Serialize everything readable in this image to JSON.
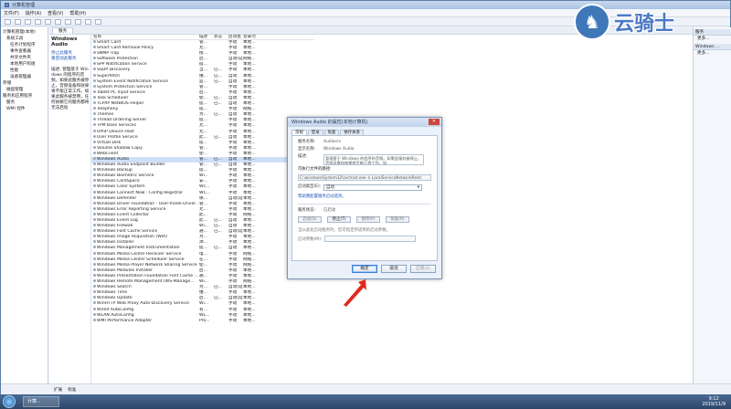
{
  "window": {
    "title": "计算机管理"
  },
  "menu": [
    "文件(F)",
    "操作(A)",
    "查看(V)",
    "帮助(H)"
  ],
  "tree": [
    "计算机管理(本地)",
    "系统工具",
    "任务计划程序",
    "事件查看器",
    "共享文件夹",
    "本地用户和组",
    "性能",
    "设备管理器",
    "存储",
    "磁盘管理",
    "服务和应用程序",
    "服务",
    "WMI 控件"
  ],
  "main_tab": "服务",
  "service_panel": {
    "title": "Windows Audio",
    "links": [
      "停止此服务",
      "重启动此服务"
    ],
    "description": "描述: 管理基于 Windows 的程序的音频。如果此服务被停止，音频设备和效果将不能正常工作。如果此服务被禁用，任何依赖它的服务都将无法启动"
  },
  "columns": [
    "名称",
    "描述",
    "状态",
    "启动类型",
    "登录为"
  ],
  "services": [
    [
      "Smart Card",
      "管...",
      "",
      "手动",
      "本地..."
    ],
    [
      "Smart Card Removal Policy",
      "允...",
      "",
      "手动",
      "本地..."
    ],
    [
      "SNMP Trap",
      "接...",
      "",
      "手动",
      "本地..."
    ],
    [
      "Software Protection",
      "启...",
      "",
      "自动(延迟...",
      "网络..."
    ],
    [
      "SPP Notification Service",
      "提...",
      "",
      "手动",
      "本地..."
    ],
    [
      "SSDP Discovery",
      "当...",
      "已...",
      "手动",
      "本地..."
    ],
    [
      "Superfetch",
      "维...",
      "已...",
      "自动",
      "本地..."
    ],
    [
      "System Event Notification Service",
      "监...",
      "已...",
      "自动",
      "本地..."
    ],
    [
      "System Protection Service",
      "管...",
      "",
      "手动",
      "本地..."
    ],
    [
      "Tablet PC Input Service",
      "启...",
      "",
      "手动",
      "本地..."
    ],
    [
      "Task Scheduler",
      "使...",
      "已...",
      "自动",
      "本地..."
    ],
    [
      "TCP/IP NetBIOS Helper",
      "提...",
      "已...",
      "自动",
      "本地..."
    ],
    [
      "Telephony",
      "提...",
      "",
      "手动",
      "网络..."
    ],
    [
      "Themes",
      "为...",
      "已...",
      "自动",
      "本地..."
    ],
    [
      "Thread Ordering Server",
      "提...",
      "",
      "手动",
      "本地..."
    ],
    [
      "TPM Base Services",
      "允...",
      "",
      "手动",
      "本地..."
    ],
    [
      "UPnP Device Host",
      "允...",
      "",
      "手动",
      "本地..."
    ],
    [
      "User Profile Service",
      "此...",
      "已...",
      "自动",
      "本地..."
    ],
    [
      "Virtual Disk",
      "提...",
      "",
      "手动",
      "本地..."
    ],
    [
      "Volume Shadow Copy",
      "管...",
      "",
      "手动",
      "本地..."
    ],
    [
      "WebClient",
      "使...",
      "",
      "手动",
      "本地..."
    ],
    [
      "Windows Audio",
      "管...",
      "已...",
      "自动",
      "本地..."
    ],
    [
      "Windows Audio Endpoint Builder",
      "管...",
      "已...",
      "自动",
      "本地..."
    ],
    [
      "Windows Backup",
      "提...",
      "",
      "手动",
      "本地..."
    ],
    [
      "Windows Biometric Service",
      "Wi...",
      "",
      "手动",
      "本地..."
    ],
    [
      "Windows CardSpace",
      "安...",
      "",
      "手动",
      "本地..."
    ],
    [
      "Windows Color System",
      "Wc...",
      "",
      "手动",
      "本地..."
    ],
    [
      "Windows Connect Now - Config Registrar",
      "WC...",
      "",
      "手动",
      "本地..."
    ],
    [
      "Windows Defender",
      "保...",
      "",
      "自动(延迟...",
      "本地..."
    ],
    [
      "Windows Driver Foundation - User-mode Driver ...",
      "管...",
      "",
      "手动",
      "本地..."
    ],
    [
      "Windows Error Reporting Service",
      "允...",
      "",
      "手动",
      "本地..."
    ],
    [
      "Windows Event Collector",
      "此...",
      "",
      "手动",
      "网络..."
    ],
    [
      "Windows Event Log",
      "此...",
      "已...",
      "自动",
      "本地..."
    ],
    [
      "Windows Firewall",
      "Wi...",
      "已...",
      "自动",
      "本地..."
    ],
    [
      "Windows Font Cache Service",
      "通...",
      "已...",
      "自动(延迟...",
      "本地..."
    ],
    [
      "Windows Image Acquisition (WIA)",
      "为...",
      "",
      "手动",
      "本地..."
    ],
    [
      "Windows Installer",
      "添...",
      "",
      "手动",
      "本地..."
    ],
    [
      "Windows Management Instrumentation",
      "提...",
      "已...",
      "自动",
      "本地..."
    ],
    [
      "Windows Media Center Receiver Service",
      "电...",
      "",
      "手动",
      "网络..."
    ],
    [
      "Windows Media Center Scheduler Service",
      "在...",
      "",
      "手动",
      "网络..."
    ],
    [
      "Windows Media Player Network Sharing Service",
      "使...",
      "",
      "手动",
      "网络..."
    ],
    [
      "Windows Modules Installer",
      "启...",
      "",
      "手动",
      "本地..."
    ],
    [
      "Windows Presentation Foundation Font Cache ...",
      "通...",
      "",
      "手动",
      "本地..."
    ],
    [
      "Windows Remote Management (WS-Manage...",
      "Wi...",
      "",
      "手动",
      "网络..."
    ],
    [
      "Windows Search",
      "为...",
      "已...",
      "自动(延迟...",
      "本地..."
    ],
    [
      "Windows Time",
      "维...",
      "",
      "手动",
      "本地..."
    ],
    [
      "Windows Update",
      "启...",
      "已...",
      "自动(延迟...",
      "本地..."
    ],
    [
      "WinHTTP Web Proxy Auto-Discovery Service",
      "Wi...",
      "",
      "手动",
      "本地..."
    ],
    [
      "Wired AutoConfig",
      "有...",
      "",
      "手动",
      "本地..."
    ],
    [
      "WLAN AutoConfig",
      "WL...",
      "",
      "手动",
      "本地..."
    ],
    [
      "WMI Performance Adapter",
      "Pro...",
      "",
      "手动",
      "本地..."
    ]
  ],
  "selected_service_index": 21,
  "actions": {
    "groups": [
      {
        "header": "服务",
        "items": [
          "更多..."
        ]
      },
      {
        "header": "Windows ...",
        "items": [
          "更多..."
        ]
      }
    ]
  },
  "status_tabs": [
    "扩展",
    "标准"
  ],
  "dialog": {
    "title": "Windows Audio 的属性(本地计算机)",
    "close": "✕",
    "tabs": [
      "常规",
      "登录",
      "恢复",
      "依存关系"
    ],
    "fields": {
      "service_name_label": "服务名称:",
      "service_name": "Audiosrv",
      "display_name_label": "显示名称:",
      "display_name": "Windows Audio",
      "description_label": "描述:",
      "description": "管理基于 Windows 的程序的音频。如果此服务被停止，音频设备和效果将不能正常工作。如",
      "path_label": "可执行文件的路径:",
      "path": "C:\\windows\\System32\\svchost.exe -k LocalServiceNetworkRestr",
      "startup_label": "启动类型(E):",
      "startup_value": "自动",
      "help_link": "帮助我配置服务启动选项。",
      "status_label": "服务状态:",
      "status_value": "已启动",
      "param_label": "启动参数(M):"
    },
    "service_buttons": [
      "启动(S)",
      "停止(T)",
      "暂停(P)",
      "恢复(R)"
    ],
    "hint": "当从此处启动服务时，您可指定所适用的启动参数。",
    "ok": "确定",
    "cancel": "取消",
    "apply": "应用(A)"
  },
  "logo": {
    "text": "云骑士"
  },
  "taskbar": {
    "task": "计算...",
    "time": "9:12",
    "date": "2019/11/9"
  },
  "colors": {
    "accent": "#3b7fd8",
    "arrow": "#e0281d",
    "selection": "#cde0f7"
  }
}
